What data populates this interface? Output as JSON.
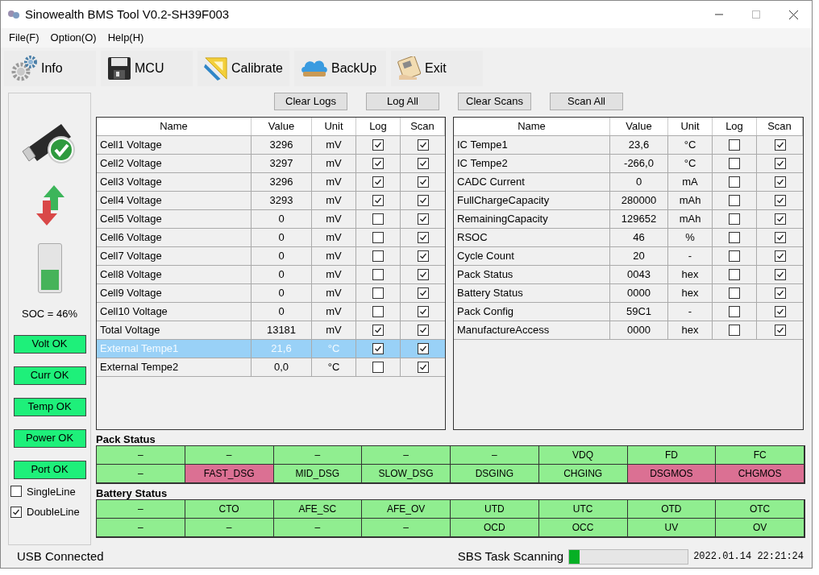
{
  "window": {
    "title": "Sinowealth BMS Tool V0.2-SH39F003"
  },
  "menu": [
    "File(F)",
    "Option(O)",
    "Help(H)"
  ],
  "toolbar": [
    {
      "kind": "gear",
      "label": "Info"
    },
    {
      "kind": "floppy",
      "label": "MCU"
    },
    {
      "kind": "ruler",
      "label": "Calibrate"
    },
    {
      "kind": "cloud",
      "label": "BackUp"
    },
    {
      "kind": "exit",
      "label": "Exit"
    }
  ],
  "actions": [
    "Clear Logs",
    "Log All",
    "Clear Scans",
    "Scan All"
  ],
  "left_panel": {
    "soc": "SOC = 46%",
    "battery": {
      "level": 0.46
    },
    "status_buttons": [
      "Volt OK",
      "Curr OK",
      "Temp OK",
      "Power OK",
      "Port OK"
    ],
    "line_options": [
      {
        "label": "SingleLine",
        "checked": false
      },
      {
        "label": "DoubleLine",
        "checked": true
      }
    ]
  },
  "tables": [
    {
      "columns": [
        "Name",
        "Value",
        "Unit",
        "Log",
        "Scan"
      ],
      "rows": [
        {
          "name": "Cell1 Voltage",
          "value": "3296",
          "unit": "mV",
          "log": true,
          "scan": true,
          "selected": false
        },
        {
          "name": "Cell2 Voltage",
          "value": "3297",
          "unit": "mV",
          "log": true,
          "scan": true,
          "selected": false
        },
        {
          "name": "Cell3 Voltage",
          "value": "3296",
          "unit": "mV",
          "log": true,
          "scan": true,
          "selected": false
        },
        {
          "name": "Cell4 Voltage",
          "value": "3293",
          "unit": "mV",
          "log": true,
          "scan": true,
          "selected": false
        },
        {
          "name": "Cell5 Voltage",
          "value": "0",
          "unit": "mV",
          "log": false,
          "scan": true,
          "selected": false
        },
        {
          "name": "Cell6 Voltage",
          "value": "0",
          "unit": "mV",
          "log": false,
          "scan": true,
          "selected": false
        },
        {
          "name": "Cell7 Voltage",
          "value": "0",
          "unit": "mV",
          "log": false,
          "scan": true,
          "selected": false
        },
        {
          "name": "Cell8 Voltage",
          "value": "0",
          "unit": "mV",
          "log": false,
          "scan": true,
          "selected": false
        },
        {
          "name": "Cell9 Voltage",
          "value": "0",
          "unit": "mV",
          "log": false,
          "scan": true,
          "selected": false
        },
        {
          "name": "Cell10 Voltage",
          "value": "0",
          "unit": "mV",
          "log": false,
          "scan": true,
          "selected": false
        },
        {
          "name": "Total Voltage",
          "value": "13181",
          "unit": "mV",
          "log": true,
          "scan": true,
          "selected": false
        },
        {
          "name": "External Tempe1",
          "value": "21,6",
          "unit": "°C",
          "log": true,
          "scan": true,
          "selected": true
        },
        {
          "name": "External Tempe2",
          "value": "0,0",
          "unit": "°C",
          "log": false,
          "scan": true,
          "selected": false
        }
      ]
    },
    {
      "columns": [
        "Name",
        "Value",
        "Unit",
        "Log",
        "Scan"
      ],
      "rows": [
        {
          "name": "IC Tempe1",
          "value": "23,6",
          "unit": "°C",
          "log": false,
          "scan": true,
          "selected": false
        },
        {
          "name": "IC Tempe2",
          "value": "-266,0",
          "unit": "°C",
          "log": false,
          "scan": true,
          "selected": false
        },
        {
          "name": "CADC Current",
          "value": "0",
          "unit": "mA",
          "log": false,
          "scan": true,
          "selected": false
        },
        {
          "name": "FullChargeCapacity",
          "value": "280000",
          "unit": "mAh",
          "log": false,
          "scan": true,
          "selected": false
        },
        {
          "name": "RemainingCapacity",
          "value": "129652",
          "unit": "mAh",
          "log": false,
          "scan": true,
          "selected": false
        },
        {
          "name": "RSOC",
          "value": "46",
          "unit": "%",
          "log": false,
          "scan": true,
          "selected": false
        },
        {
          "name": "Cycle Count",
          "value": "20",
          "unit": "-",
          "log": false,
          "scan": true,
          "selected": false
        },
        {
          "name": "Pack Status",
          "value": "0043",
          "unit": "hex",
          "log": false,
          "scan": true,
          "selected": false
        },
        {
          "name": "Battery Status",
          "value": "0000",
          "unit": "hex",
          "log": false,
          "scan": true,
          "selected": false
        },
        {
          "name": "Pack Config",
          "value": "59C1",
          "unit": "-",
          "log": false,
          "scan": true,
          "selected": false
        },
        {
          "name": "ManufactureAccess",
          "value": "0000",
          "unit": "hex",
          "log": false,
          "scan": true,
          "selected": false
        }
      ]
    }
  ],
  "status_groups": [
    {
      "title": "Pack Status",
      "cells": [
        {
          "text": "–",
          "color": "#90ee90"
        },
        {
          "text": "–",
          "color": "#90ee90"
        },
        {
          "text": "–",
          "color": "#90ee90"
        },
        {
          "text": "–",
          "color": "#90ee90"
        },
        {
          "text": "–",
          "color": "#90ee90"
        },
        {
          "text": "VDQ",
          "color": "#90ee90"
        },
        {
          "text": "FD",
          "color": "#90ee90"
        },
        {
          "text": "FC",
          "color": "#90ee90"
        },
        {
          "text": "–",
          "color": "#90ee90"
        },
        {
          "text": "FAST_DSG",
          "color": "#db7093"
        },
        {
          "text": "MID_DSG",
          "color": "#90ee90"
        },
        {
          "text": "SLOW_DSG",
          "color": "#90ee90"
        },
        {
          "text": "DSGING",
          "color": "#90ee90"
        },
        {
          "text": "CHGING",
          "color": "#90ee90"
        },
        {
          "text": "DSGMOS",
          "color": "#db7093"
        },
        {
          "text": "CHGMOS",
          "color": "#db7093"
        }
      ]
    },
    {
      "title": "Battery Status",
      "cells": [
        {
          "text": "–",
          "color": "#90ee90"
        },
        {
          "text": "CTO",
          "color": "#90ee90"
        },
        {
          "text": "AFE_SC",
          "color": "#90ee90"
        },
        {
          "text": "AFE_OV",
          "color": "#90ee90"
        },
        {
          "text": "UTD",
          "color": "#90ee90"
        },
        {
          "text": "UTC",
          "color": "#90ee90"
        },
        {
          "text": "OTD",
          "color": "#90ee90"
        },
        {
          "text": "OTC",
          "color": "#90ee90"
        },
        {
          "text": "–",
          "color": "#90ee90"
        },
        {
          "text": "–",
          "color": "#90ee90"
        },
        {
          "text": "–",
          "color": "#90ee90"
        },
        {
          "text": "–",
          "color": "#90ee90"
        },
        {
          "text": "OCD",
          "color": "#90ee90"
        },
        {
          "text": "OCC",
          "color": "#90ee90"
        },
        {
          "text": "UV",
          "color": "#90ee90"
        },
        {
          "text": "OV",
          "color": "#90ee90"
        }
      ]
    }
  ],
  "status_bar": {
    "connection": "USB Connected",
    "task": "SBS Task Scanning",
    "level": 0.09,
    "datetime": "2022.01.14 22:21:24"
  }
}
